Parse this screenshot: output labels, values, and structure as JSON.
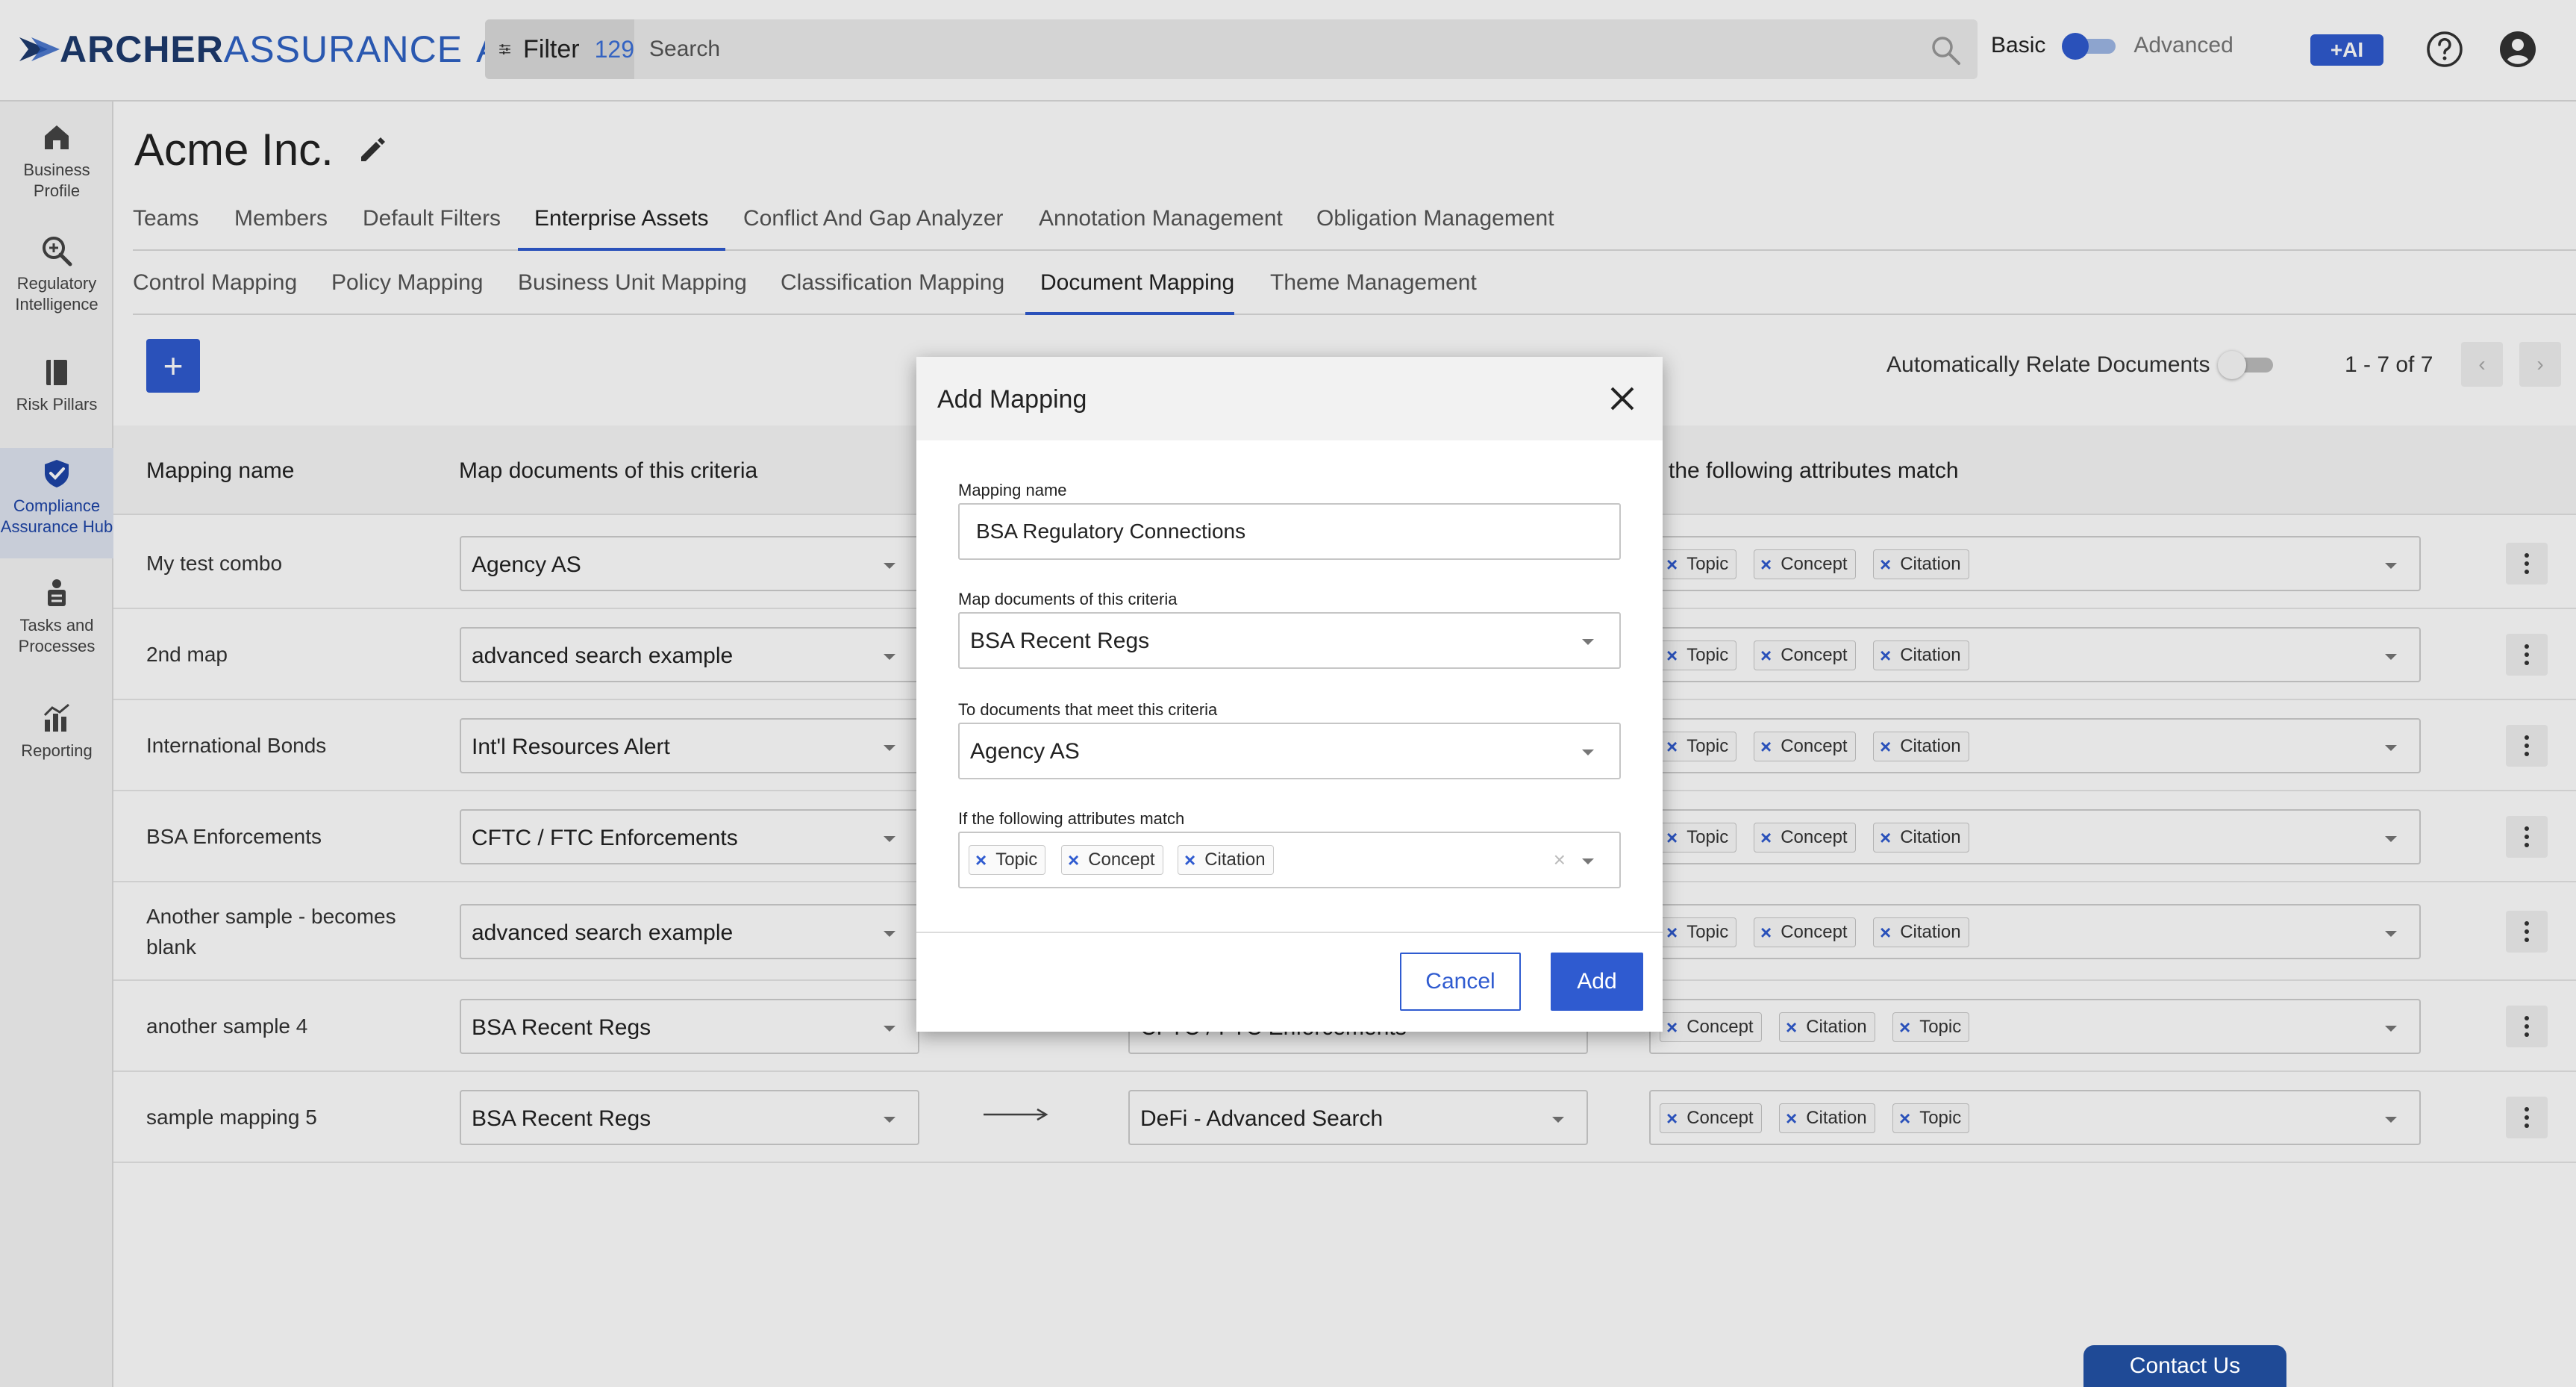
{
  "header": {
    "logo_primary": "ARCHER",
    "logo_secondary": "ASSURANCE",
    "logo_suffix": "AI",
    "filter_label": "Filter",
    "filter_count": "129",
    "search_placeholder": "Search",
    "mode_basic": "Basic",
    "mode_advanced": "Advanced",
    "ai_label": "+AI"
  },
  "sidebar": {
    "items": [
      {
        "label": "Business Profile",
        "icon": "business-profile-icon"
      },
      {
        "label": "Regulatory Intelligence",
        "icon": "regulatory-intelligence-icon"
      },
      {
        "label": "Risk Pillars",
        "icon": "risk-pillars-icon"
      },
      {
        "label": "Compliance Assurance Hub",
        "icon": "compliance-hub-icon",
        "active": true
      },
      {
        "label": "Tasks and Processes",
        "icon": "tasks-icon"
      },
      {
        "label": "Reporting",
        "icon": "reporting-icon"
      }
    ]
  },
  "page": {
    "title": "Acme Inc."
  },
  "tabs_primary": [
    "Teams",
    "Members",
    "Default Filters",
    "Enterprise Assets",
    "Conflict And Gap Analyzer",
    "Annotation Management",
    "Obligation Management"
  ],
  "tabs_secondary": [
    "Control Mapping",
    "Policy Mapping",
    "Business Unit Mapping",
    "Classification Mapping",
    "Document Mapping",
    "Theme Management"
  ],
  "toolbar": {
    "add_label": "+",
    "auto_relate_label": "Automatically Relate Documents",
    "pager_text": "1 - 7 of 7",
    "prev_label": "‹",
    "next_label": "›"
  },
  "table": {
    "headers": [
      "Mapping name",
      "Map documents of this criteria",
      "the following attributes match"
    ],
    "rows": [
      {
        "name": "My test combo",
        "from": "Agency AS",
        "to": "",
        "attrs": [
          "Topic",
          "Concept",
          "Citation"
        ]
      },
      {
        "name": "2nd map",
        "from": "advanced search example",
        "to": "",
        "attrs": [
          "Topic",
          "Concept",
          "Citation"
        ]
      },
      {
        "name": "International Bonds",
        "from": "Int'l Resources Alert",
        "to": "",
        "attrs": [
          "Topic",
          "Concept",
          "Citation"
        ]
      },
      {
        "name": "BSA Enforcements",
        "from": "CFTC / FTC Enforcements",
        "to": "",
        "attrs": [
          "Topic",
          "Concept",
          "Citation"
        ]
      },
      {
        "name": "Another sample - becomes blank",
        "from": "advanced search example",
        "to": "",
        "attrs": [
          "Topic",
          "Concept",
          "Citation"
        ]
      },
      {
        "name": "another sample 4",
        "from": "BSA Recent Regs",
        "to": "CFTC / FTC Enforcements",
        "attrs": [
          "Concept",
          "Citation",
          "Topic"
        ]
      },
      {
        "name": "sample mapping 5",
        "from": "BSA Recent Regs",
        "to": "DeFi - Advanced Search",
        "attrs": [
          "Concept",
          "Citation",
          "Topic"
        ]
      }
    ]
  },
  "modal": {
    "title": "Add Mapping",
    "mapping_name_label": "Mapping name",
    "mapping_name_value": "BSA Regulatory Connections",
    "map_criteria_label": "Map documents of this criteria",
    "map_criteria_value": "BSA Recent Regs",
    "to_criteria_label": "To documents that meet this criteria",
    "to_criteria_value": "Agency AS",
    "attrs_label": "If the following attributes match",
    "attrs": [
      "Topic",
      "Concept",
      "Citation"
    ],
    "clear_label": "×",
    "cancel_label": "Cancel",
    "add_label": "Add"
  },
  "footer": {
    "contact_label": "Contact Us"
  },
  "colors": {
    "accent": "#2f5bd0",
    "brand_dark": "#1d3a6e",
    "contact_bg": "#1f4a96"
  }
}
